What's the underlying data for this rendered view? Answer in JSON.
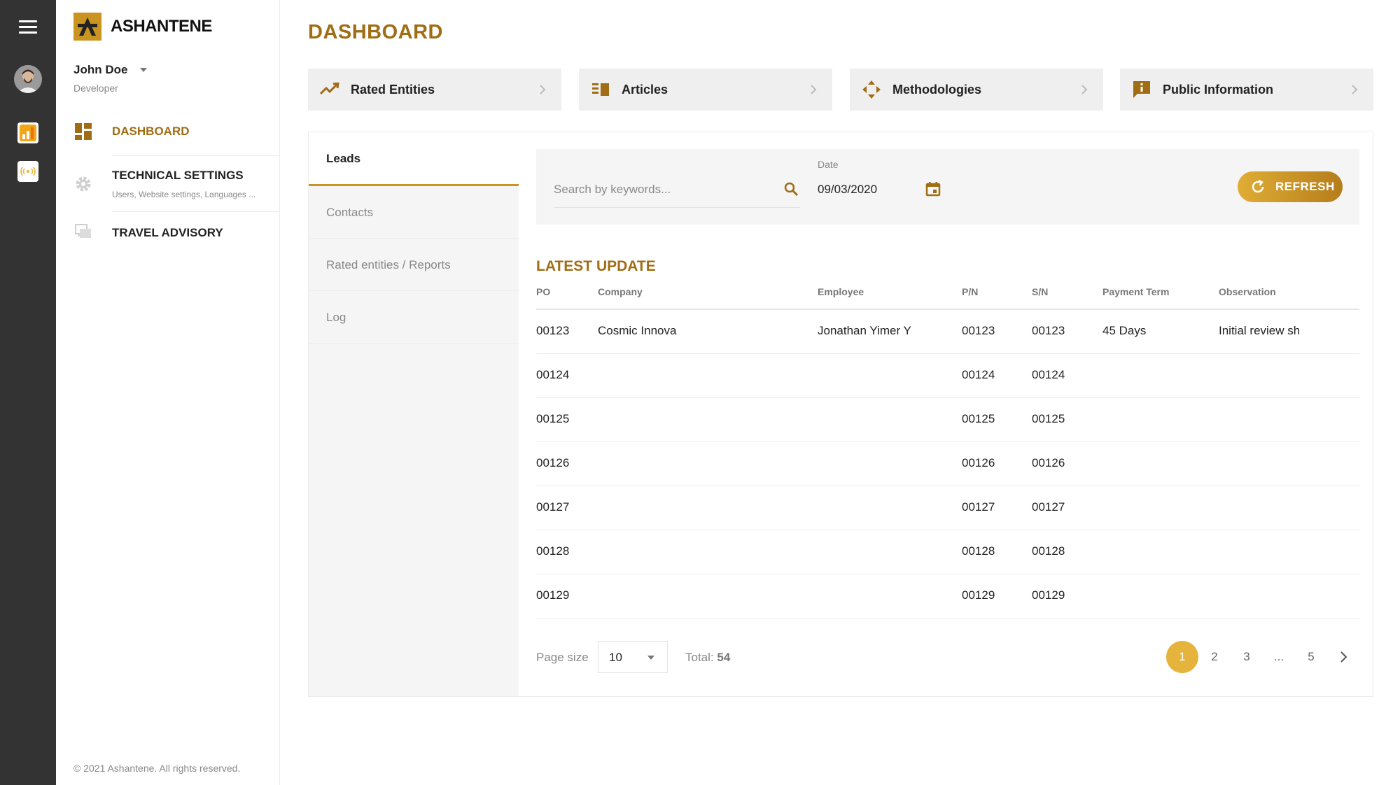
{
  "brand": {
    "name": "ASHANTENE"
  },
  "user": {
    "name": "John Doe",
    "role": "Developer"
  },
  "sidebar": {
    "items": [
      {
        "label": "DASHBOARD",
        "sub": ""
      },
      {
        "label": "TECHNICAL SETTINGS",
        "sub": "Users, Website settings, Languages ..."
      },
      {
        "label": "TRAVEL ADVISORY",
        "sub": ""
      }
    ]
  },
  "copyright": "© 2021 Ashantene. All rights reserved.",
  "page": {
    "title": "DASHBOARD"
  },
  "cards": [
    {
      "label": "Rated Entities",
      "icon": "trending-up-icon"
    },
    {
      "label": "Articles",
      "icon": "articles-icon"
    },
    {
      "label": "Methodologies",
      "icon": "arrows-move-icon"
    },
    {
      "label": "Public Information",
      "icon": "info-icon"
    }
  ],
  "tabs": [
    {
      "label": "Leads"
    },
    {
      "label": "Contacts"
    },
    {
      "label": "Rated entities / Reports"
    },
    {
      "label": "Log"
    }
  ],
  "filter": {
    "search_placeholder": "Search by keywords...",
    "date_label": "Date",
    "date_value": "09/03/2020",
    "refresh_label": "REFRESH"
  },
  "latest": {
    "title": "LATEST UPDATE",
    "headers": [
      "PO",
      "Company",
      "Employee",
      "P/N",
      "S/N",
      "Payment Term",
      "Observation"
    ],
    "rows": [
      [
        "00123",
        "Cosmic Innova",
        "Jonathan Yimer Y",
        "00123",
        "00123",
        "45 Days",
        "Initial review sh"
      ],
      [
        "00124",
        "",
        "",
        "00124",
        "00124",
        "",
        ""
      ],
      [
        "00125",
        "",
        "",
        "00125",
        "00125",
        "",
        ""
      ],
      [
        "00126",
        "",
        "",
        "00126",
        "00126",
        "",
        ""
      ],
      [
        "00127",
        "",
        "",
        "00127",
        "00127",
        "",
        ""
      ],
      [
        "00128",
        "",
        "",
        "00128",
        "00128",
        "",
        ""
      ],
      [
        "00129",
        "",
        "",
        "00129",
        "00129",
        "",
        ""
      ]
    ]
  },
  "pagination": {
    "page_size_label": "Page size",
    "page_size": "10",
    "total_label": "Total:",
    "total": "54",
    "pages": [
      "1",
      "2",
      "3",
      "...",
      "5"
    ],
    "active": "1"
  },
  "colors": {
    "accent": "#a06c14",
    "accent_light": "#e6b43c",
    "rail": "#333333"
  }
}
